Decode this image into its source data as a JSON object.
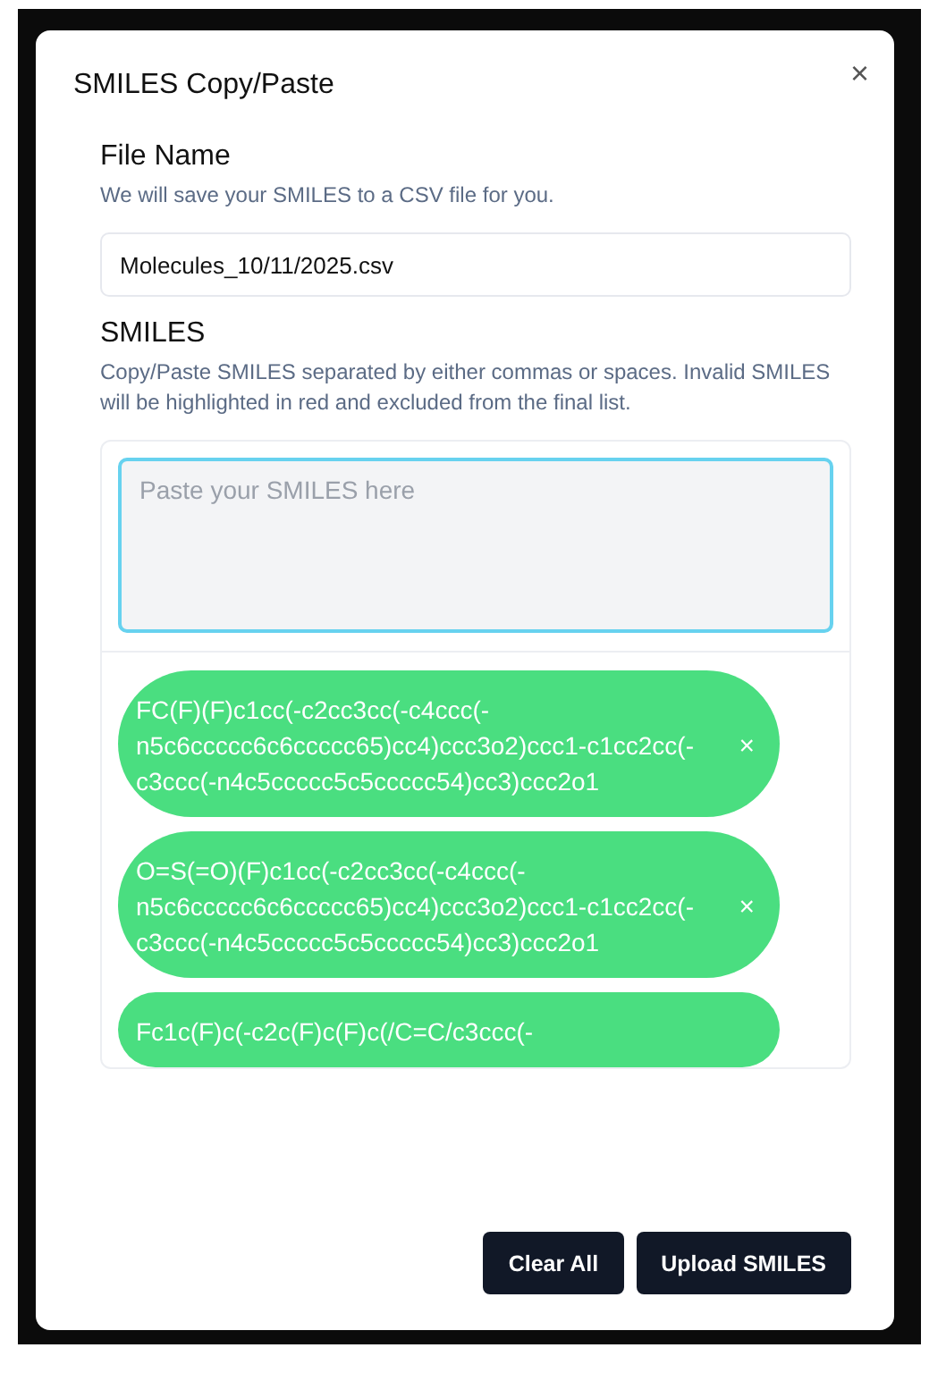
{
  "dialog": {
    "title": "SMILES Copy/Paste",
    "close": "×"
  },
  "file_name": {
    "label": "File Name",
    "hint": "We will save your SMILES to a CSV file for you.",
    "value": "Molecules_10/11/2025.csv"
  },
  "smiles": {
    "label": "SMILES",
    "hint": "Copy/Paste SMILES separated by either commas or spaces. Invalid SMILES will be highlighted in red and excluded from the final list.",
    "placeholder": "Paste your SMILES here",
    "chips": [
      {
        "text": "FC(F)(F)c1cc(-c2cc3cc(-c4ccc(-n5c6ccccc6c6ccccc65)cc4)ccc3o2)ccc1-c1cc2cc(-c3ccc(-n4c5ccccc5c5ccccc54)cc3)ccc2o1",
        "valid": true,
        "remove": "×"
      },
      {
        "text": "O=S(=O)(F)c1cc(-c2cc3cc(-c4ccc(-n5c6ccccc6c6ccccc65)cc4)ccc3o2)ccc1-c1cc2cc(-c3ccc(-n4c5ccccc5c5ccccc54)cc3)ccc2o1",
        "valid": true,
        "remove": "×"
      },
      {
        "text": "Fc1c(F)c(-c2c(F)c(F)c(/C=C/c3ccc(-",
        "valid": true
      }
    ]
  },
  "buttons": [
    {
      "label": "Clear All"
    },
    {
      "label": "Upload SMILES"
    }
  ]
}
